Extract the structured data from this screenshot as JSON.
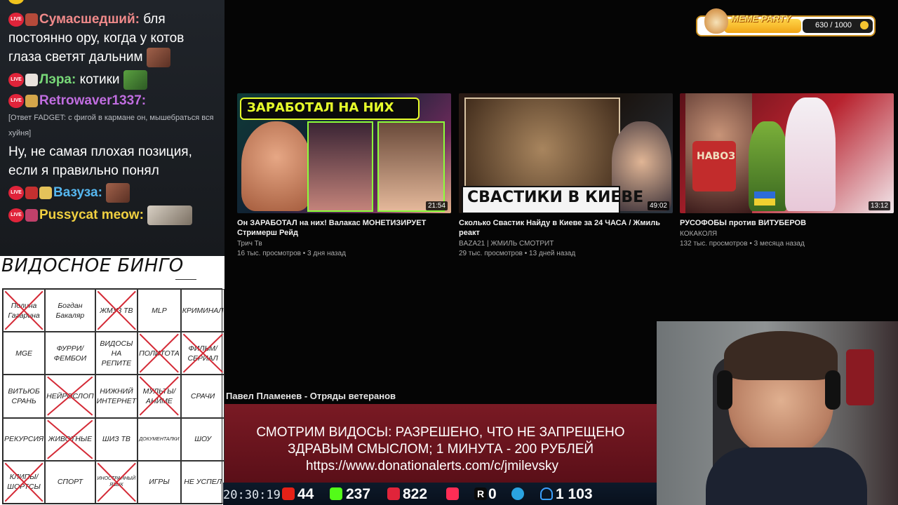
{
  "chat": {
    "messages": [
      {
        "user": "Сумасшедший:",
        "text": "бля постоянно ору, когда у котов глаза светят дальним",
        "user_color": "#f08a8a"
      },
      {
        "user": "Лэра:",
        "text": "котики",
        "user_color": "#78d878"
      },
      {
        "user": "Retrowaver1337:",
        "reply": "[Ответ FADGET: с фигой в кармане он, мышебраться вся хуйня]",
        "user_color": "#c06de0"
      },
      {
        "text": "Ну, не самая плохая позиция, если я правильно понял"
      },
      {
        "user": "Вазуза:",
        "user_color": "#56b7f0"
      },
      {
        "user": "Pussycat meow:",
        "user_color": "#f0d040"
      }
    ],
    "live_label": "LIVE"
  },
  "bingo": {
    "title": "ВИДОСНОЕ БИНГО",
    "cells": [
      {
        "text": "Полина Гагарина",
        "crossed": true
      },
      {
        "text": "Богдан Бакаляр",
        "crossed": false
      },
      {
        "text": "ЖМУ3 ТВ",
        "crossed": true
      },
      {
        "text": "MLP",
        "crossed": false
      },
      {
        "text": "КРИМИНАЛ",
        "crossed": false
      },
      {
        "text": "MGE",
        "crossed": false
      },
      {
        "text": "ФУРРИ/ ФЕМБОИ",
        "crossed": false
      },
      {
        "text": "ВИДОСЫ НА РЕПИТЕ",
        "crossed": false
      },
      {
        "text": "ПОЛИТОТА",
        "crossed": true
      },
      {
        "text": "ФИЛЬМ/ СЕРИАЛ",
        "crossed": true
      },
      {
        "text": "ВИТЬЮБ СРАНЬ",
        "crossed": false
      },
      {
        "text": "НЕЙРОСЛОП",
        "crossed": true
      },
      {
        "text": "НИЖНИЙ ИНТЕРНЕТ",
        "crossed": false
      },
      {
        "text": "МУЛЬТЫ/ АНИМЕ",
        "crossed": true
      },
      {
        "text": "СРАЧИ",
        "crossed": false
      },
      {
        "text": "РЕКУРСИЯ",
        "crossed": false
      },
      {
        "text": "ЖИВОТНЫЕ",
        "crossed": true
      },
      {
        "text": "ШИЗ ТВ",
        "crossed": false
      },
      {
        "text": "ДОКУМЕНТАЛКИ",
        "crossed": false,
        "small": true
      },
      {
        "text": "ШОУ",
        "crossed": false
      },
      {
        "text": "КЛИПЫ/ ШОРТСЫ",
        "crossed": true
      },
      {
        "text": "СПОРТ",
        "crossed": false
      },
      {
        "text": "ИНОСТРАННЫЙ ЯЗЫК",
        "crossed": true,
        "small": true
      },
      {
        "text": "ИГРЫ",
        "crossed": false
      },
      {
        "text": "НЕ УСПЕЛ",
        "crossed": false
      }
    ]
  },
  "meme_party": {
    "label": "MEME PARTY",
    "score": "630 / 1000"
  },
  "videos": [
    {
      "title": "Он ЗАРАБОТАЛ на них! Валакас МОНЕТИЗИРУЕТ Стримерш Рейд",
      "channel": "Трич Тв",
      "meta": "16 тыс. просмотров • 3 дня назад",
      "duration": "21:54",
      "thumb_text": "ЗАРАБОТАЛ НА НИХ"
    },
    {
      "title": "Сколько Свастик Найду в Киеве за 24 ЧАСА / Жмиль реакт",
      "channel": "BAZA21 | ЖМИЛЬ СМОТРИТ",
      "meta": "29 тыс. просмотров • 13 дней назад",
      "duration": "49:02",
      "thumb_text": "СВАСТИКИ В КИЕВЕ"
    },
    {
      "title": "РУСОФОБЫ против ВИТУБЕРОВ",
      "channel": "КОКАКОЛЯ",
      "meta": "132 тыс. просмотров • 3 месяца назад",
      "duration": "13:12",
      "thumb_text": "НАВОЗ"
    }
  ],
  "now_playing": "Павел Пламенев - Отряды ветеранов",
  "banner": {
    "line1": "СМОТРИМ ВИДОСЫ: РАЗРЕШЕНО, ЧТО НЕ ЗАПРЕЩЕНО",
    "line2": "ЗДРАВЫМ СМЫСЛОМ; 1 МИНУТА - 200 РУБЛЕЙ",
    "line3": "https://www.donationalerts.com/c/jmilevsky"
  },
  "stats": {
    "time": "20:30:19",
    "youtube": "44",
    "kick": "237",
    "live": "822",
    "rutube": "0",
    "total": "1 103"
  },
  "colors": {
    "accent_red": "#e0243a",
    "banner": "#6a1420",
    "bingo_cross": "#d42a36"
  }
}
